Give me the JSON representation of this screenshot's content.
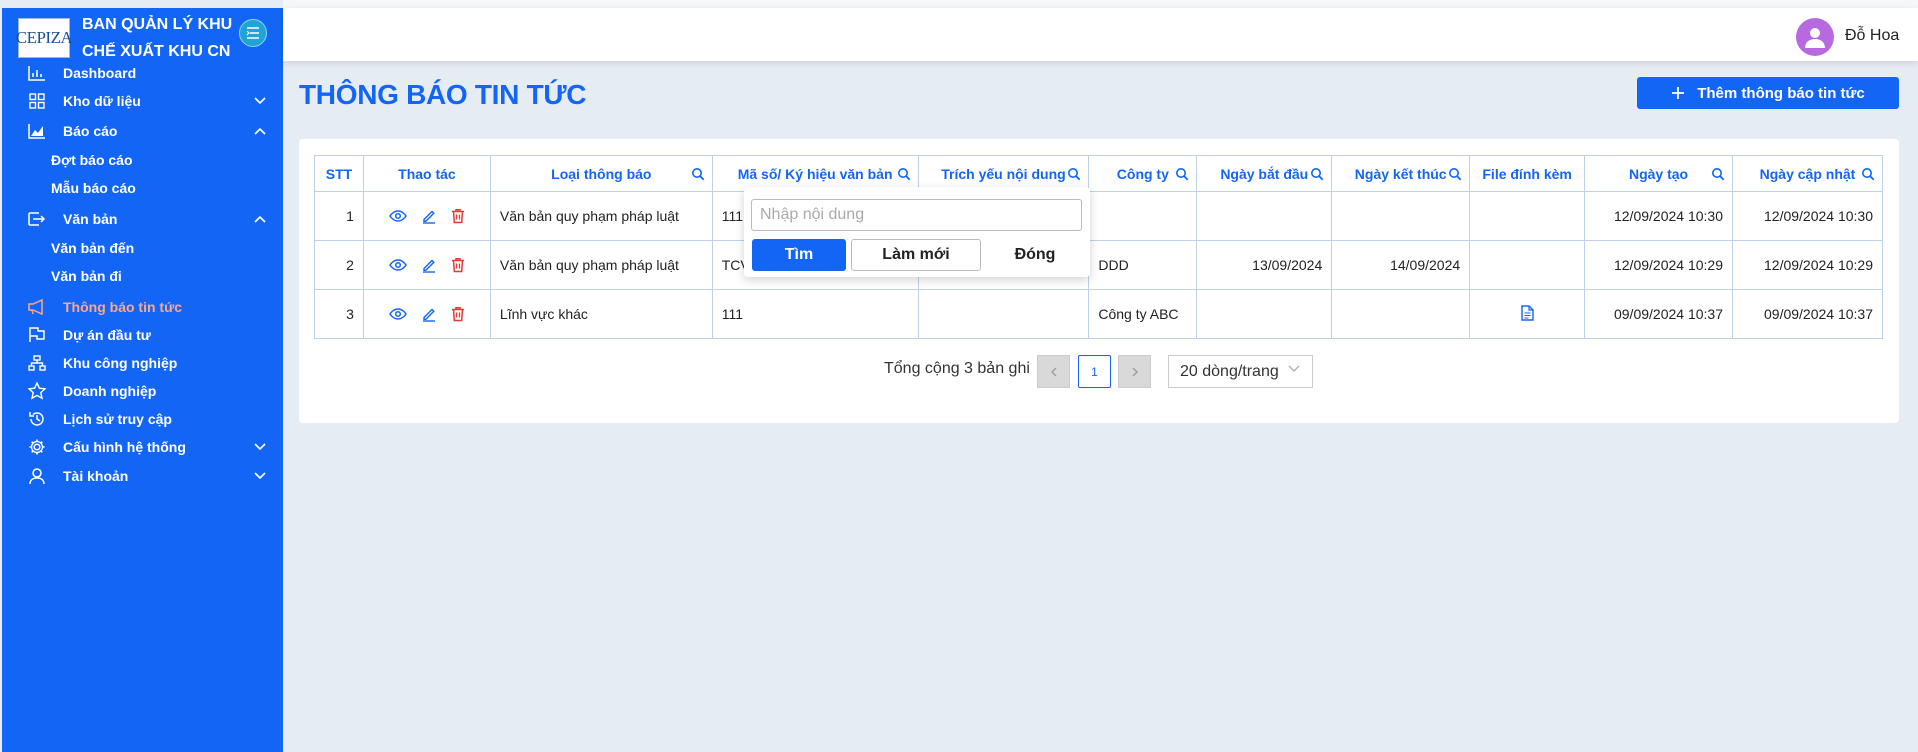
{
  "brand": {
    "logo": "CEPIZA",
    "line1": "BAN QUẢN LÝ KHU",
    "line2": "CHẾ XUẤT KHU CN"
  },
  "sidebar": {
    "items": [
      {
        "label": "Dashboard",
        "icon": "bar-chart-icon"
      },
      {
        "label": "Kho dữ liệu",
        "icon": "grid-icon"
      },
      {
        "label": "Báo cáo",
        "icon": "area-chart-icon"
      },
      {
        "label": "Đợt báo cáo"
      },
      {
        "label": "Mẫu báo cáo"
      },
      {
        "label": "Văn bản",
        "icon": "document-send-icon"
      },
      {
        "label": "Văn bản đến"
      },
      {
        "label": "Văn bản đi"
      },
      {
        "label": "Thông báo tin tức",
        "icon": "megaphone-icon"
      },
      {
        "label": "Dự án đầu tư",
        "icon": "flag-icon"
      },
      {
        "label": "Khu công nghiệp",
        "icon": "hierarchy-icon"
      },
      {
        "label": "Doanh nghiệp",
        "icon": "star-icon"
      },
      {
        "label": "Lịch sử truy cập",
        "icon": "history-icon"
      },
      {
        "label": "Cấu hình hệ thống",
        "icon": "gear-icon"
      },
      {
        "label": "Tài khoản",
        "icon": "user-icon"
      }
    ],
    "active_color": "#ffa58a"
  },
  "header": {
    "username": "Đỗ Hoa"
  },
  "page": {
    "title": "THÔNG BÁO TIN TỨC",
    "add_button": "Thêm thông báo tin tức"
  },
  "table": {
    "columns": [
      "STT",
      "Thao tác",
      "Loại thông báo",
      "Mã số/ Ký hiệu văn bản",
      "Trích yếu nội dung",
      "Công ty",
      "Ngày bắt đầu",
      "Ngày kết thúc",
      "File đính kèm",
      "Ngày tạo",
      "Ngày cập nhật"
    ],
    "rows": [
      {
        "stt": "1",
        "type": "Văn bản quy phạm pháp luật",
        "code": "111",
        "summary": "",
        "company": "",
        "start": "",
        "end": "",
        "file": false,
        "created": "12/09/2024 10:30",
        "updated": "12/09/2024 10:30"
      },
      {
        "stt": "2",
        "type": "Văn bản quy phạm pháp luật",
        "code": "TCV",
        "summary": "",
        "company": "DDD",
        "start": "13/09/2024",
        "end": "14/09/2024",
        "file": false,
        "created": "12/09/2024 10:29",
        "updated": "12/09/2024 10:29"
      },
      {
        "stt": "3",
        "type": "Lĩnh vực khác",
        "code": "111",
        "summary": "",
        "company": "Công ty ABC",
        "start": "",
        "end": "",
        "file": true,
        "created": "09/09/2024 10:37",
        "updated": "09/09/2024 10:37"
      }
    ]
  },
  "pagination": {
    "total": "Tổng cộng 3 bản ghi",
    "current": "1",
    "page_size": "20 dòng/trang"
  },
  "filter_popup": {
    "placeholder": "Nhập nội dung",
    "find": "Tìm",
    "reset": "Làm mới",
    "close": "Đóng"
  },
  "colors": {
    "primary": "#1366f5",
    "sidebar": "#1366f5",
    "background": "#e6ecf4",
    "delete": "#e53935"
  }
}
